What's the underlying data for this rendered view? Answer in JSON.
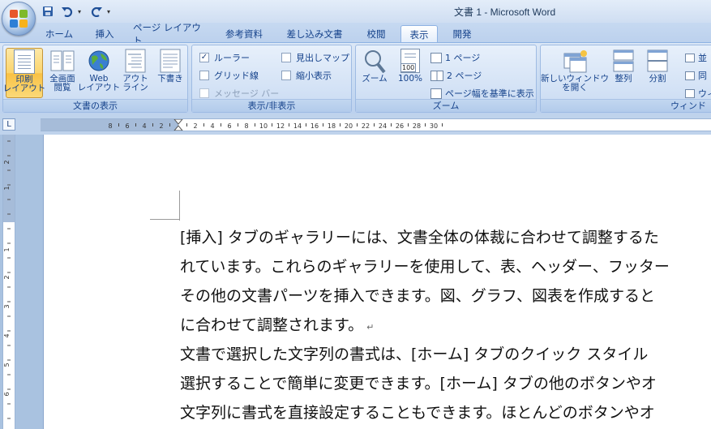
{
  "window": {
    "title": "文書 1 - Microsoft Word"
  },
  "quick_access": {
    "save_icon": "save-icon",
    "undo_icon": "undo-icon",
    "redo_icon": "redo-icon",
    "customize": "▾"
  },
  "tabs": [
    "ホーム",
    "挿入",
    "ページ レイアウト",
    "参考資料",
    "差し込み文書",
    "校閲",
    "表示",
    "開発"
  ],
  "active_tab": "表示",
  "ribbon": {
    "views_group": {
      "label": "文書の表示",
      "buttons": [
        {
          "label1": "印刷",
          "label2": "レイアウト",
          "icon": "print-layout-icon",
          "selected": true
        },
        {
          "label1": "全画面",
          "label2": "閲覧",
          "icon": "full-screen-reading-icon"
        },
        {
          "label1": "Web",
          "label2": "レイアウト",
          "icon": "web-layout-icon"
        },
        {
          "label1": "アウト",
          "label2": "ライン",
          "icon": "outline-icon"
        },
        {
          "label1": "下書き",
          "label2": "",
          "icon": "draft-icon"
        }
      ]
    },
    "showhide_group": {
      "label": "表示/非表示",
      "checks": [
        {
          "label": "ルーラー",
          "checked": true,
          "enabled": true
        },
        {
          "label": "グリッド線",
          "checked": false,
          "enabled": true
        },
        {
          "label": "メッセージ バー",
          "checked": false,
          "enabled": false
        },
        {
          "label": "見出しマップ",
          "checked": false,
          "enabled": true
        },
        {
          "label": "縮小表示",
          "checked": false,
          "enabled": true
        }
      ]
    },
    "zoom_group": {
      "label": "ズーム",
      "zoom_label": "ズーム",
      "hundred_label": "100%",
      "hundred_icon_text": "100",
      "one_page": "1 ページ",
      "two_pages": "2 ページ",
      "page_width": "ページ幅を基準に表示"
    },
    "window_group": {
      "label": "ウィンド",
      "new_window_1": "新しいウィンドウ",
      "new_window_2": "を開く",
      "arrange": "整列",
      "split": "分割",
      "side_by_side": "並",
      "sync": "同",
      "reset": "ウィ"
    }
  },
  "ruler": {
    "tab_selector": "L",
    "left_labels": [
      "8",
      "6",
      "4",
      "2"
    ],
    "right_labels": [
      "2",
      "4",
      "6",
      "8",
      "10",
      "12",
      "14",
      "16",
      "18",
      "20",
      "22",
      "24",
      "26",
      "28",
      "30"
    ]
  },
  "vruler": {
    "labels": [
      "2",
      "1",
      "1",
      "2",
      "3",
      "4",
      "5",
      "6"
    ]
  },
  "document": {
    "lines": [
      "[挿入] タブのギャラリーには、文書全体の体裁に合わせて調整するた",
      "れています。これらのギャラリーを使用して、表、ヘッダー、フッター",
      "その他の文書パーツを挿入できます。図、グラフ、図表を作成すると",
      "に合わせて調整されます。",
      "文書で選択した文字列の書式は、[ホーム] タブのクイック スタイル",
      "選択することで簡単に変更できます。[ホーム] タブの他のボタンやオ",
      "文字列に書式を直接設定することもできます。ほとんどのボタンやオ"
    ],
    "paragraph_mark": "↵"
  }
}
